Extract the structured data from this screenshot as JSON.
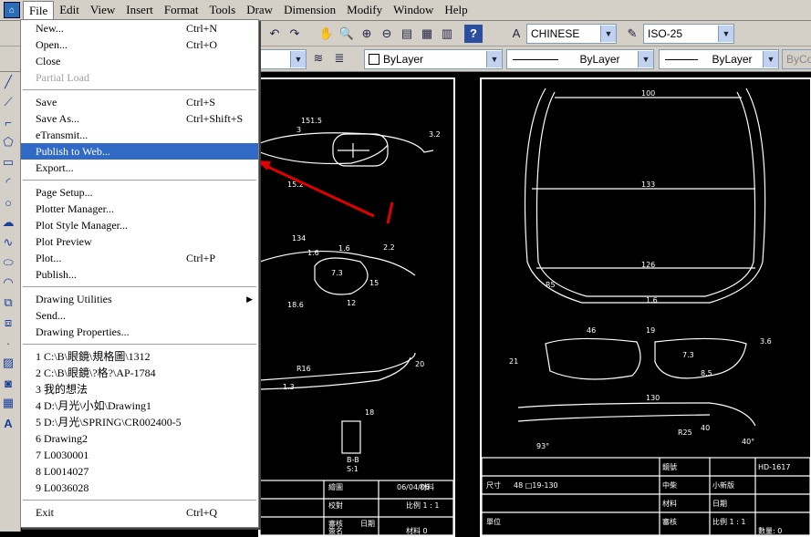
{
  "menubar": {
    "items": [
      "File",
      "Edit",
      "View",
      "Insert",
      "Format",
      "Tools",
      "Draw",
      "Dimension",
      "Modify",
      "Window",
      "Help"
    ]
  },
  "toolbar1": {
    "text_style": "CHINESE",
    "dim_style": "ISO-25"
  },
  "toolbar2": {
    "color": "ByLayer",
    "linetype": "ByLayer",
    "lineweight": "ByLayer",
    "plotstyle": "ByCo"
  },
  "file_menu": {
    "groups": [
      [
        {
          "label": "New...",
          "shortcut": "Ctrl+N"
        },
        {
          "label": "Open...",
          "shortcut": "Ctrl+O"
        },
        {
          "label": "Close",
          "shortcut": ""
        },
        {
          "label": "Partial Load",
          "shortcut": "",
          "disabled": true
        }
      ],
      [
        {
          "label": "Save",
          "shortcut": "Ctrl+S"
        },
        {
          "label": "Save As...",
          "shortcut": "Ctrl+Shift+S"
        },
        {
          "label": "eTransmit...",
          "shortcut": ""
        },
        {
          "label": "Publish to Web...",
          "shortcut": "",
          "selected": true
        },
        {
          "label": "Export...",
          "shortcut": ""
        }
      ],
      [
        {
          "label": "Page Setup...",
          "shortcut": ""
        },
        {
          "label": "Plotter Manager...",
          "shortcut": ""
        },
        {
          "label": "Plot Style Manager...",
          "shortcut": ""
        },
        {
          "label": "Plot Preview",
          "shortcut": ""
        },
        {
          "label": "Plot...",
          "shortcut": "Ctrl+P"
        },
        {
          "label": "Publish...",
          "shortcut": ""
        }
      ],
      [
        {
          "label": "Drawing Utilities",
          "shortcut": "",
          "submenu": true
        },
        {
          "label": "Send...",
          "shortcut": ""
        },
        {
          "label": "Drawing Properties...",
          "shortcut": ""
        }
      ],
      [
        {
          "label": "1 C:\\B\\眼鏡\\規格圖\\1312",
          "shortcut": ""
        },
        {
          "label": "2 C:\\B\\眼鏡\\?格?\\AP-1784",
          "shortcut": ""
        },
        {
          "label": "3 我的想法",
          "shortcut": ""
        },
        {
          "label": "4 D:\\月光\\小如\\Drawing1",
          "shortcut": ""
        },
        {
          "label": "5 D:\\月光\\SPRING\\CR002400-5",
          "shortcut": ""
        },
        {
          "label": "6 Drawing2",
          "shortcut": ""
        },
        {
          "label": "7 L0030001",
          "shortcut": ""
        },
        {
          "label": "8 L0014027",
          "shortcut": ""
        },
        {
          "label": "9 L0036028",
          "shortcut": ""
        }
      ],
      [
        {
          "label": "Exit",
          "shortcut": "Ctrl+Q"
        }
      ]
    ]
  },
  "drawing_right": {
    "dims": [
      "100",
      "133",
      "126",
      "46",
      "19",
      "7.3",
      "130",
      "R25",
      "40",
      "40°",
      "93°",
      "8.5",
      "3.6",
      "21",
      "1.6",
      "R5"
    ],
    "title_block": [
      "鏡號",
      "HD-1617",
      "中柴",
      "小新版",
      "尺寸",
      "48 □19-130",
      "材料",
      "日期",
      "審核",
      "比例 1 : 1",
      "單位",
      "數量: 0"
    ]
  },
  "drawing_left": {
    "dims": [
      "151.5",
      "3",
      "3.2",
      "15.2",
      "134",
      "1.6",
      "1.6",
      "2.2",
      "7.3",
      "15",
      "12",
      "18.6",
      "R16",
      "20",
      "1.3",
      "18",
      "B-B",
      "S:1"
    ],
    "title_block": [
      "繪圖",
      "06/04/06",
      "材料",
      "校對",
      "比例 1 : 1",
      "審核",
      "日期",
      "簽名",
      "材料 0"
    ]
  },
  "colors": {
    "menu_highlight": "#316ac5",
    "arrow": "#e00000",
    "window_bg": "#d4d0c8"
  }
}
